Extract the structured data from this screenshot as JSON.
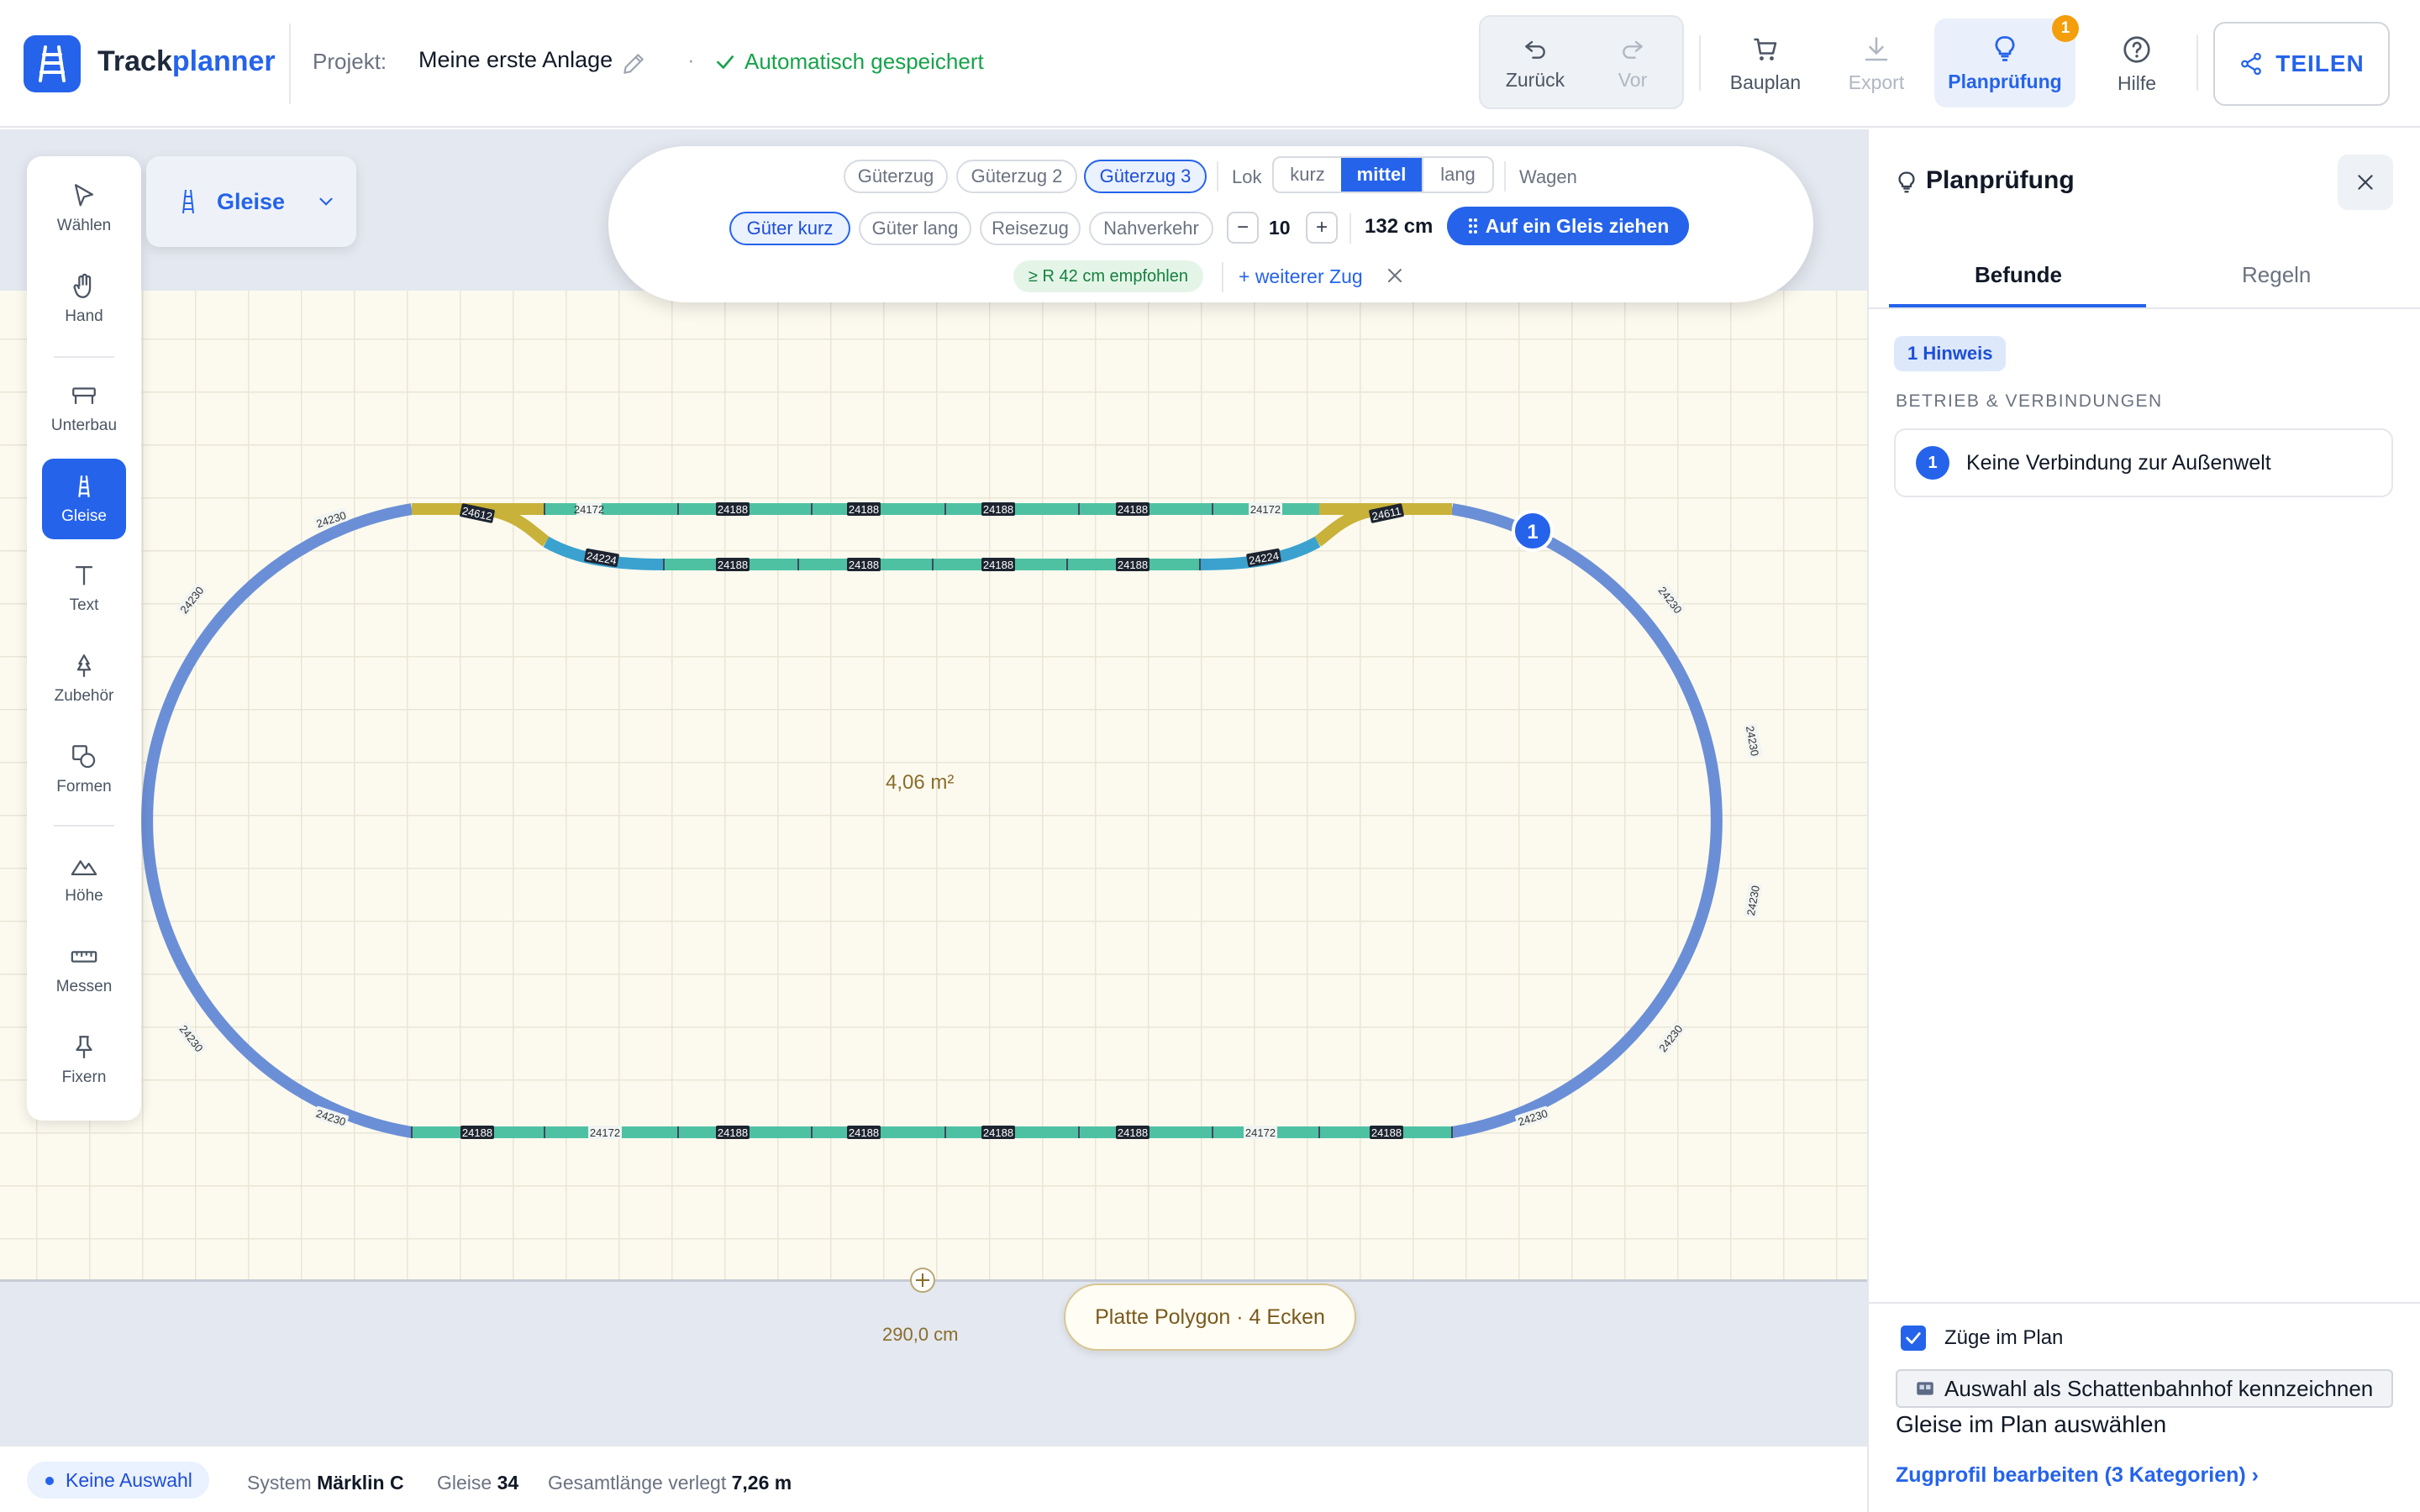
{
  "header": {
    "app_title_main": "Track",
    "app_title_accent": "planner",
    "project_label": "Projekt:",
    "project_name": "Meine erste Anlage",
    "separator": "·",
    "autosave": "Automatisch gespeichert",
    "undo_label": "Zurück",
    "redo_label": "Vor",
    "bauplan_label": "Bauplan",
    "export_label": "Export",
    "planpruefung_label": "Planprüfung",
    "planpruefung_badge": "1",
    "help_label": "Hilfe",
    "share_label": "TEILEN"
  },
  "toolbox": {
    "items": [
      {
        "label": "Wählen",
        "icon": "pointer-icon"
      },
      {
        "label": "Hand",
        "icon": "hand-icon"
      },
      {
        "label": "Unterbau",
        "icon": "bench-icon"
      },
      {
        "label": "Gleise",
        "icon": "track-icon"
      },
      {
        "label": "Text",
        "icon": "text-icon"
      },
      {
        "label": "Zubehör",
        "icon": "tree-icon"
      },
      {
        "label": "Formen",
        "icon": "shapes-icon"
      },
      {
        "label": "Höhe",
        "icon": "mountain-icon"
      },
      {
        "label": "Messen",
        "icon": "ruler-icon"
      },
      {
        "label": "Fixern",
        "icon": "pin-icon"
      }
    ],
    "active": "Gleise"
  },
  "category_dropdown": {
    "label": "Gleise"
  },
  "train_panel": {
    "trains": [
      "Güterzug",
      "Güterzug 2",
      "Güterzug 3"
    ],
    "selected_train": "Güterzug 3",
    "lok_label": "Lok",
    "lok_sizes": [
      "kurz",
      "mittel",
      "lang"
    ],
    "selected_lok_size": "mittel",
    "wagen_label": "Wagen",
    "profiles": [
      "Güter kurz",
      "Güter lang",
      "Reisezug",
      "Nahverkehr"
    ],
    "selected_profile": "Güter kurz",
    "minus": "−",
    "plus": "+",
    "wagon_count": "10",
    "length": "132 cm",
    "drag_button": "Auf ein Gleis ziehen",
    "recommendation": "≥ R 42 cm empfohlen",
    "add_train": "+ weiterer Zug"
  },
  "canvas": {
    "area_label": "4,06 m²",
    "width_label": "290,0 cm",
    "plate_label": "Platte Polygon · 4 Ecken",
    "issue_marker": "1",
    "track_labels": {
      "curve": "24230",
      "straight_long": "24188",
      "straight_short": "24172",
      "switch_left": "24612",
      "switch_right": "24611",
      "curve_small": "24224"
    }
  },
  "statusbar": {
    "selection": "Keine Auswahl",
    "system_label": "System",
    "system_value": "Märklin C",
    "tracks_label": "Gleise",
    "tracks_value": "34",
    "length_label": "Gesamtlänge verlegt",
    "length_value": "7,26 m"
  },
  "side_panel": {
    "title": "Planprüfung",
    "tabs": [
      "Befunde",
      "Regeln"
    ],
    "active_tab": "Befunde",
    "hint_count": "1 Hinweis",
    "section": "BETRIEB & VERBINDUNGEN",
    "findings": [
      {
        "num": "1",
        "text": "Keine Verbindung zur Außenwelt"
      }
    ],
    "trains_checkbox": "Züge im Plan",
    "shadow_button": "Auswahl als Schattenbahnhof kennzeichnen",
    "select_label": "Gleise im Plan auswählen",
    "profile_link": "Zugprofil bearbeiten (3 Kategorien) ›"
  },
  "colors": {
    "accent": "#2563eb",
    "curve": "#6b8fd6",
    "straight": "#4fc1a3",
    "switch": "#c9b23a",
    "curve_small": "#3ba2cf",
    "success": "#16a34a",
    "badge": "#f59e0b"
  }
}
